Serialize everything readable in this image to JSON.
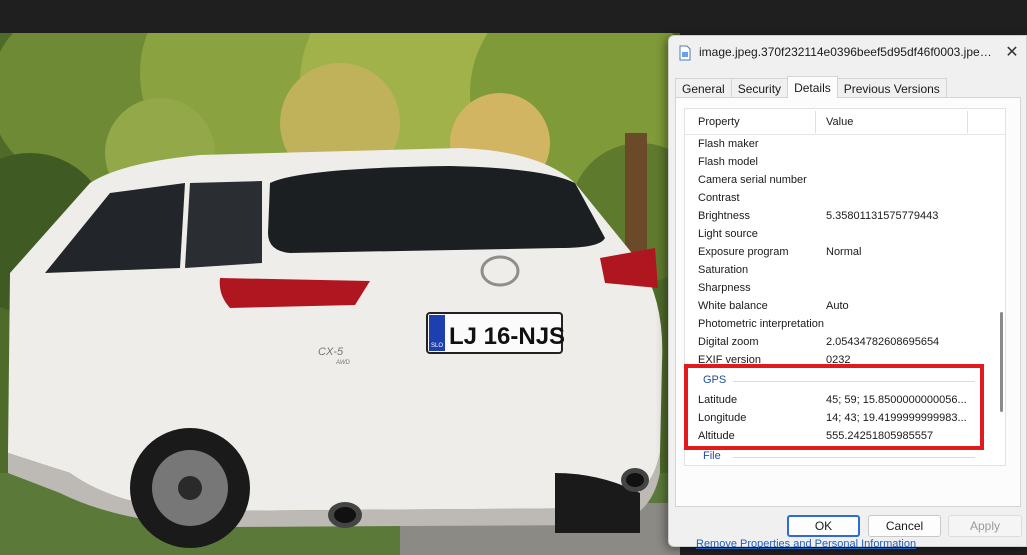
{
  "dialog": {
    "title": "image.jpeg.370f232114e0396beef5d95df46f0003.jpeg...",
    "tabs": [
      {
        "label": "General"
      },
      {
        "label": "Security"
      },
      {
        "label": "Details"
      },
      {
        "label": "Previous Versions"
      }
    ],
    "columns": {
      "property": "Property",
      "value": "Value"
    },
    "rows": [
      {
        "property": "Flash maker",
        "value": ""
      },
      {
        "property": "Flash model",
        "value": ""
      },
      {
        "property": "Camera serial number",
        "value": ""
      },
      {
        "property": "Contrast",
        "value": ""
      },
      {
        "property": "Brightness",
        "value": "5.35801131575779443"
      },
      {
        "property": "Light source",
        "value": ""
      },
      {
        "property": "Exposure program",
        "value": "Normal"
      },
      {
        "property": "Saturation",
        "value": ""
      },
      {
        "property": "Sharpness",
        "value": ""
      },
      {
        "property": "White balance",
        "value": "Auto"
      },
      {
        "property": "Photometric interpretation",
        "value": ""
      },
      {
        "property": "Digital zoom",
        "value": "2.05434782608695654"
      },
      {
        "property": "EXIF version",
        "value": "0232"
      }
    ],
    "gps_section": "GPS",
    "gps_rows": [
      {
        "property": "Latitude",
        "value": "45; 59; 15.8500000000056..."
      },
      {
        "property": "Longitude",
        "value": "14; 43; 19.4199999999983..."
      },
      {
        "property": "Altitude",
        "value": "555.24251805985557"
      }
    ],
    "file_section": "File",
    "remove_link": "Remove Properties and Personal Information",
    "buttons": {
      "ok": "OK",
      "cancel": "Cancel",
      "apply": "Apply"
    }
  },
  "photo": {
    "plate": "LJ 16-NJS",
    "plate_country": "SLO",
    "badge": "CX-5",
    "badge_sub": "AWD"
  }
}
